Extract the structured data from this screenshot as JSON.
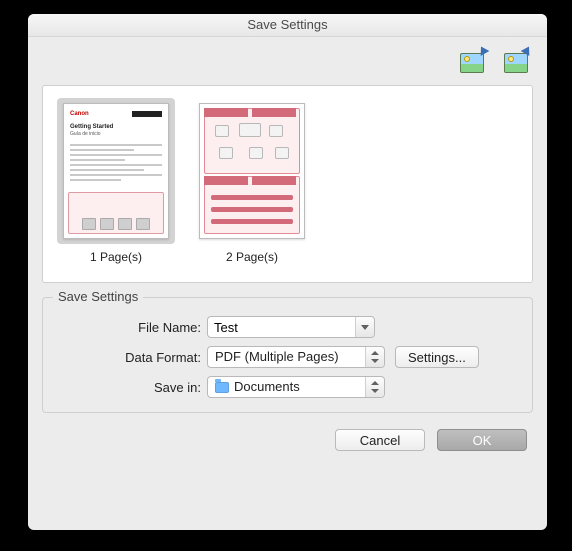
{
  "window": {
    "title": "Save Settings"
  },
  "toolbar": {
    "rotate_left_icon": "rotate-left-icon",
    "rotate_right_icon": "rotate-right-icon"
  },
  "thumbnails": [
    {
      "label": "1 Page(s)",
      "selected": true
    },
    {
      "label": "2 Page(s)",
      "selected": false
    }
  ],
  "group": {
    "title": "Save Settings",
    "file_name_label": "File Name:",
    "file_name_value": "Test",
    "data_format_label": "Data Format:",
    "data_format_value": "PDF (Multiple Pages)",
    "settings_button": "Settings...",
    "save_in_label": "Save in:",
    "save_in_value": "Documents"
  },
  "footer": {
    "cancel": "Cancel",
    "ok": "OK"
  }
}
